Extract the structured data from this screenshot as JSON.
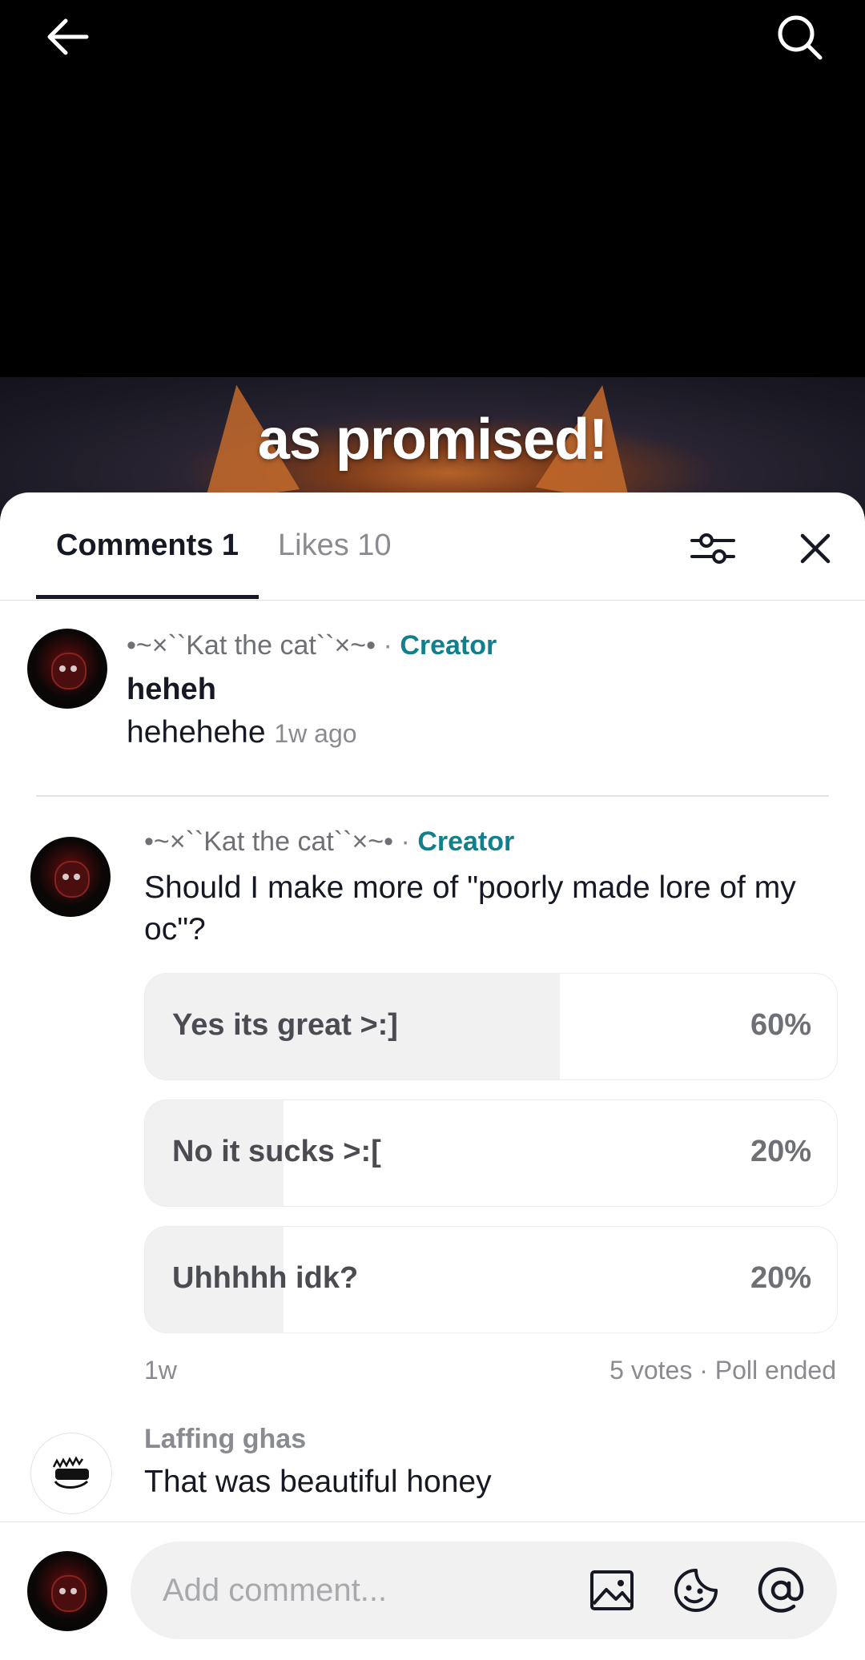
{
  "video": {
    "caption": "as promised!"
  },
  "tabs": [
    {
      "label": "Comments 1"
    },
    {
      "label": "Likes 10"
    }
  ],
  "comments": [
    {
      "username": "•~×``Kat the cat``×~•",
      "badge": "Creator",
      "title": "heheh",
      "body": "hehehehe",
      "time": "1w ago"
    }
  ],
  "poll": {
    "username": "•~×``Kat the cat``×~•",
    "badge": "Creator",
    "question": "Should I make more of \"poorly made lore of my oc\"?",
    "options": [
      {
        "label": "Yes its great >:]",
        "percent": "60%",
        "fill": 0.6
      },
      {
        "label": "No it sucks >:[",
        "percent": "20%",
        "fill": 0.2
      },
      {
        "label": "Uhhhhh idk?",
        "percent": "20%",
        "fill": 0.2
      }
    ],
    "time": "1w",
    "votes": "5 votes",
    "status": "Poll ended"
  },
  "reply": {
    "username": "Laffing ghas",
    "text": "That was beautiful honey"
  },
  "composer": {
    "placeholder": "Add comment..."
  },
  "separator": "·",
  "colors": {
    "creator": "#117f8c",
    "text": "#161823",
    "muted": "#8a8b91",
    "poll_fill": "#f1f1f2"
  }
}
